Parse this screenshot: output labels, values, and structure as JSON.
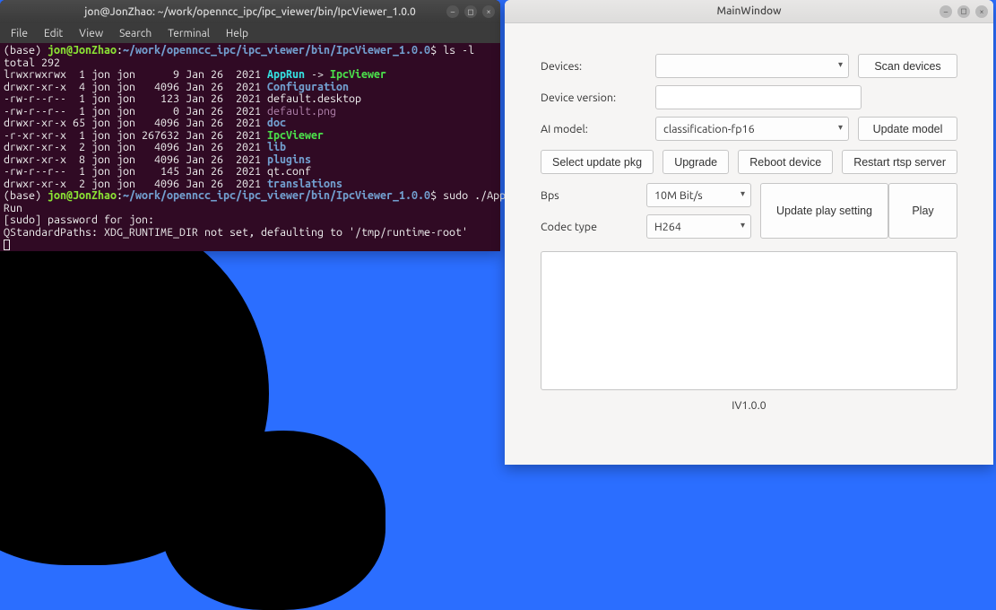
{
  "terminal": {
    "title": "jon@JonZhao: ~/work/openncc_ipc/ipc_viewer/bin/IpcViewer_1.0.0",
    "menu": [
      "File",
      "Edit",
      "View",
      "Search",
      "Terminal",
      "Help"
    ],
    "prompt_env": "(base) ",
    "prompt_userhost": "jon@JonZhao",
    "prompt_colon": ":",
    "prompt_path": "~/work/openncc_ipc/ipc_viewer/bin/IpcViewer_1.0.0",
    "prompt_dollar": "$ ",
    "cmd1": "ls -l",
    "total": "total 292",
    "ls": [
      {
        "perm": "lrwxrwxrwx",
        "n": " 1",
        "own": "jon jon",
        "size": "     9",
        "date": "Jan 26  2021",
        "name": "AppRun",
        "arrow": " -> ",
        "target": "IpcViewer",
        "cls": "p-cyan",
        "tcls": "p-bgreen"
      },
      {
        "perm": "drwxr-xr-x",
        "n": " 4",
        "own": "jon jon",
        "size": "  4096",
        "date": "Jan 26  2021",
        "name": "Configuration",
        "cls": "p-blue"
      },
      {
        "perm": "-rw-r--r--",
        "n": " 1",
        "own": "jon jon",
        "size": "   123",
        "date": "Jan 26  2021",
        "name": "default.desktop",
        "cls": "p-white"
      },
      {
        "perm": "-rw-r--r--",
        "n": " 1",
        "own": "jon jon",
        "size": "     0",
        "date": "Jan 26  2021",
        "name": "default.png",
        "cls": "p-purple"
      },
      {
        "perm": "drwxr-xr-x",
        "n": "65",
        "own": "jon jon",
        "size": "  4096",
        "date": "Jan 26  2021",
        "name": "doc",
        "cls": "p-blue"
      },
      {
        "perm": "-r-xr-xr-x",
        "n": " 1",
        "own": "jon jon",
        "size": "267632",
        "date": "Jan 26  2021",
        "name": "IpcViewer",
        "cls": "p-bgreen"
      },
      {
        "perm": "drwxr-xr-x",
        "n": " 2",
        "own": "jon jon",
        "size": "  4096",
        "date": "Jan 26  2021",
        "name": "lib",
        "cls": "p-blue"
      },
      {
        "perm": "drwxr-xr-x",
        "n": " 8",
        "own": "jon jon",
        "size": "  4096",
        "date": "Jan 26  2021",
        "name": "plugins",
        "cls": "p-blue"
      },
      {
        "perm": "-rw-r--r--",
        "n": " 1",
        "own": "jon jon",
        "size": "   145",
        "date": "Jan 26  2021",
        "name": "qt.conf",
        "cls": "p-white"
      },
      {
        "perm": "drwxr-xr-x",
        "n": " 2",
        "own": "jon jon",
        "size": "  4096",
        "date": "Jan 26  2021",
        "name": "translations",
        "cls": "p-blue"
      }
    ],
    "cmd2_part1": "sudo ./App",
    "cmd2_part2": "Run",
    "sudo_line": "[sudo] password for jon: ",
    "xdg_line": "QStandardPaths: XDG_RUNTIME_DIR not set, defaulting to '/tmp/runtime-root'"
  },
  "mainwin": {
    "title": "MainWindow",
    "labels": {
      "devices": "Devices:",
      "device_version": "Device version:",
      "ai_model": "AI model:",
      "bps": "Bps",
      "codec_type": "Codec type"
    },
    "values": {
      "devices": "",
      "device_version": "",
      "ai_model": "classification-fp16",
      "bps": "10M Bit/s",
      "codec_type": "H264"
    },
    "buttons": {
      "scan_devices": "Scan devices",
      "update_model": "Update model",
      "select_update_pkg": "Select update pkg",
      "upgrade": "Upgrade",
      "reboot_device": "Reboot device",
      "restart_rtsp": "Restart rtsp server",
      "update_play_setting": "Update play setting",
      "play": "Play"
    },
    "footer": "IV1.0.0"
  }
}
